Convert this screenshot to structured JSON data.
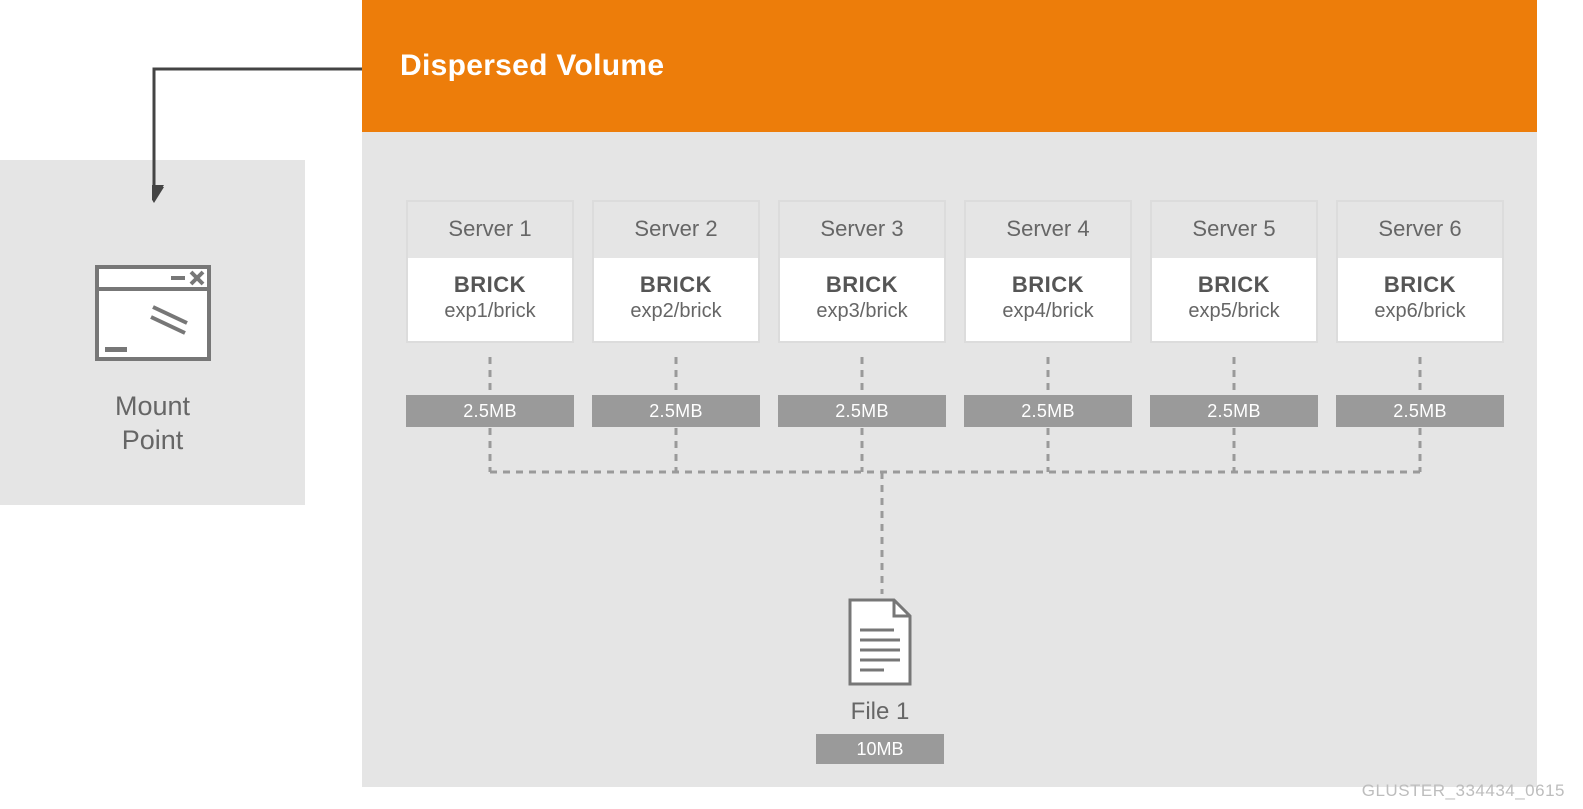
{
  "header": {
    "title": "Dispersed Volume"
  },
  "mount": {
    "label_line1": "Mount",
    "label_line2": "Point"
  },
  "servers": [
    {
      "name": "Server 1",
      "brick_label": "BRICK",
      "brick_path": "exp1/brick",
      "chunk_size": "2.5MB"
    },
    {
      "name": "Server 2",
      "brick_label": "BRICK",
      "brick_path": "exp2/brick",
      "chunk_size": "2.5MB"
    },
    {
      "name": "Server 3",
      "brick_label": "BRICK",
      "brick_path": "exp3/brick",
      "chunk_size": "2.5MB"
    },
    {
      "name": "Server 4",
      "brick_label": "BRICK",
      "brick_path": "exp4/brick",
      "chunk_size": "2.5MB"
    },
    {
      "name": "Server 5",
      "brick_label": "BRICK",
      "brick_path": "exp5/brick",
      "chunk_size": "2.5MB"
    },
    {
      "name": "Server 6",
      "brick_label": "BRICK",
      "brick_path": "exp6/brick",
      "chunk_size": "2.5MB"
    }
  ],
  "file": {
    "label": "File 1",
    "size": "10MB"
  },
  "footer": {
    "id": "GLUSTER_334434_0615"
  }
}
